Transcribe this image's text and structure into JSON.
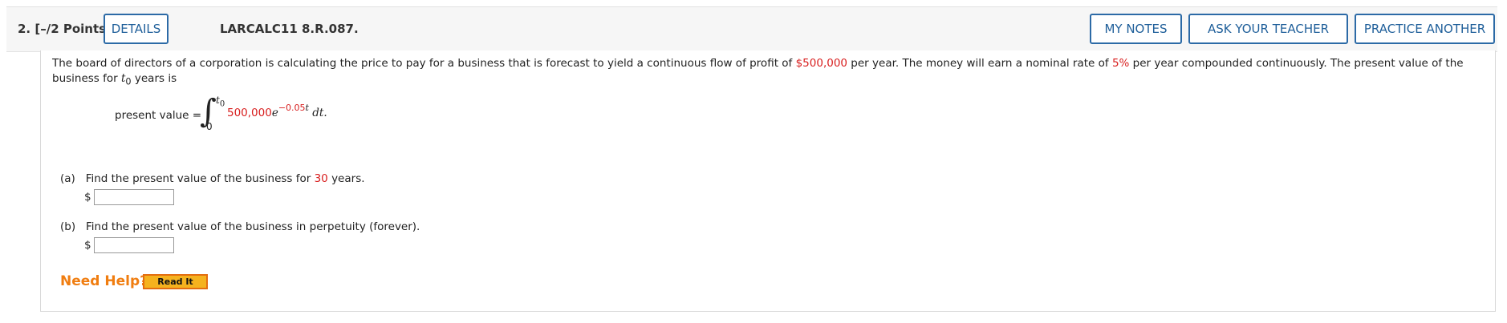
{
  "header": {
    "question_number": "2.",
    "points": "[–/2 Points]",
    "details_label": "DETAILS",
    "question_id": "LARCALC11 8.R.087.",
    "my_notes_label": "MY NOTES",
    "ask_teacher_label": "ASK YOUR TEACHER",
    "practice_another_label": "PRACTICE ANOTHER"
  },
  "problem": {
    "statement_1": "The board of directors of a corporation is calculating the price to pay for a business that is forecast to yield a continuous flow of profit of ",
    "profit": "$500,000",
    "statement_2": " per year. The money will earn a nominal rate of ",
    "rate": "5%",
    "statement_3": " per year compounded continuously. The present value of the business for ",
    "t0_var": "t",
    "t0_sub": "0",
    "statement_4": " years is",
    "pv_label": "present value =",
    "integral_sign": "∫",
    "upper_limit": "t",
    "upper_limit_sub": "0",
    "lower_limit": "0",
    "integrand_coef": "500,000",
    "integrand_e": "e",
    "integrand_exp": "−0.05",
    "integrand_exp_var": "t",
    "integrand_dt": "dt."
  },
  "part_a": {
    "label": "(a)",
    "text_1": "Find the present value of the business for ",
    "years": "30",
    "text_2": " years.",
    "currency": "$",
    "value": ""
  },
  "part_b": {
    "label": "(b)",
    "text": "Find the present value of the business in perpetuity (forever).",
    "currency": "$",
    "value": ""
  },
  "help": {
    "need_help": "Need Help?",
    "read_it_label": "Read It"
  },
  "colors": {
    "accent_blue": "#2c6aa6",
    "highlight_red": "#d81e1e",
    "help_orange": "#f07d10"
  }
}
